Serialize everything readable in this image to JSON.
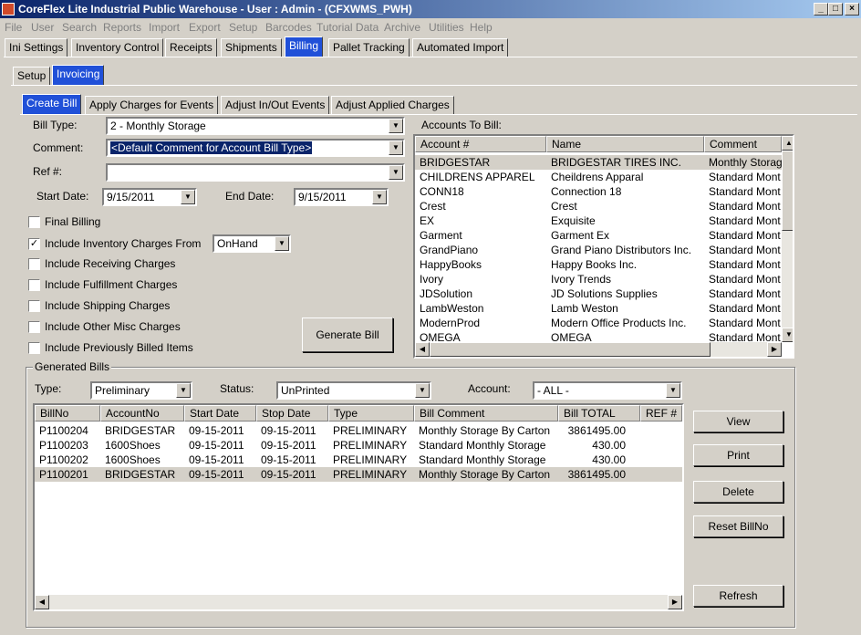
{
  "window": {
    "title": "CoreFlex Lite Industrial Public Warehouse - User : Admin - (CFXWMS_PWH)",
    "controls": [
      "_",
      "□",
      "×"
    ]
  },
  "menu": [
    "File",
    "User",
    "Search",
    "Reports",
    "Import",
    "Export",
    "Setup",
    "Barcodes",
    "Tutorial Data",
    "Archive",
    "Utilities",
    "Help"
  ],
  "main_tabs": [
    "Ini Settings",
    "Inventory Control",
    "Receipts",
    "Shipments",
    "Billing",
    "Pallet Tracking",
    "Automated Import"
  ],
  "billing_tabs": [
    "Setup",
    "Invoicing"
  ],
  "invoicing_tabs": [
    "Create Bill",
    "Apply Charges for Events",
    "Adjust In/Out Events",
    "Adjust Applied Charges"
  ],
  "form": {
    "bill_type_label": "Bill Type:",
    "bill_type_value": "2 - Monthly Storage",
    "comment_label": "Comment:",
    "comment_value": "<Default Comment for Account Bill Type>",
    "ref_label": "Ref #:",
    "ref_value": "",
    "start_date_label": "Start Date:",
    "start_date_value": "9/15/2011",
    "end_date_label": "End Date:",
    "end_date_value": "9/15/2011",
    "checkboxes": [
      {
        "label": "Final Billing",
        "checked": false
      },
      {
        "label": "Include Inventory Charges From",
        "checked": true
      },
      {
        "label": "Include Receiving Charges",
        "checked": false
      },
      {
        "label": "Include Fulfillment Charges",
        "checked": false
      },
      {
        "label": "Include Shipping Charges",
        "checked": false
      },
      {
        "label": "Include Other Misc Charges",
        "checked": false
      },
      {
        "label": "Include Previously Billed Items",
        "checked": false
      }
    ],
    "inventory_from_value": "OnHand",
    "generate_button": "Generate Bill"
  },
  "accounts": {
    "title": "Accounts To Bill:",
    "columns": [
      "Account #",
      "Name",
      "Comment"
    ],
    "rows": [
      [
        "BRIDGESTAR",
        "BRIDGESTAR TIRES INC.",
        "Monthly Storag"
      ],
      [
        "CHILDRENS APPAREL",
        "Cheildrens Apparal",
        "Standard Mont"
      ],
      [
        "CONN18",
        "Connection 18",
        "Standard Mont"
      ],
      [
        "Crest",
        "Crest",
        "Standard Mont"
      ],
      [
        "EX",
        "Exquisite",
        "Standard Mont"
      ],
      [
        "Garment",
        "Garment Ex",
        "Standard Mont"
      ],
      [
        "GrandPiano",
        "Grand Piano Distributors Inc.",
        "Standard Mont"
      ],
      [
        "HappyBooks",
        "Happy Books Inc.",
        "Standard Mont"
      ],
      [
        "Ivory",
        "Ivory Trends",
        "Standard Mont"
      ],
      [
        "JDSolution",
        "JD Solutions Supplies",
        "Standard Mont"
      ],
      [
        "LambWeston",
        "Lamb Weston",
        "Standard Mont"
      ],
      [
        "ModernProd",
        "Modern Office Products Inc.",
        "Standard Mont"
      ],
      [
        "OMEGA",
        "OMEGA",
        "Standard Mont"
      ]
    ]
  },
  "generated": {
    "group_title": "Generated Bills",
    "type_label": "Type:",
    "type_value": "Preliminary",
    "status_label": "Status:",
    "status_value": "UnPrinted",
    "account_label": "Account:",
    "account_value": "- ALL -",
    "columns": [
      "BillNo",
      "AccountNo",
      "Start Date",
      "Stop Date",
      "Type",
      "Bill Comment",
      "Bill TOTAL",
      "REF #"
    ],
    "rows": [
      [
        "P1100204",
        "BRIDGESTAR",
        "09-15-2011",
        "09-15-2011",
        "PRELIMINARY",
        "Monthly Storage By Carton",
        "3861495.00",
        ""
      ],
      [
        "P1100203",
        "1600Shoes",
        "09-15-2011",
        "09-15-2011",
        "PRELIMINARY",
        "Standard Monthly Storage",
        "430.00",
        ""
      ],
      [
        "P1100202",
        "1600Shoes",
        "09-15-2011",
        "09-15-2011",
        "PRELIMINARY",
        "Standard Monthly Storage",
        "430.00",
        ""
      ],
      [
        "P1100201",
        "BRIDGESTAR",
        "09-15-2011",
        "09-15-2011",
        "PRELIMINARY",
        "Monthly Storage By Carton",
        "3861495.00",
        ""
      ]
    ],
    "buttons": [
      "View",
      "Print",
      "Delete",
      "Reset BillNo",
      "Refresh"
    ]
  }
}
